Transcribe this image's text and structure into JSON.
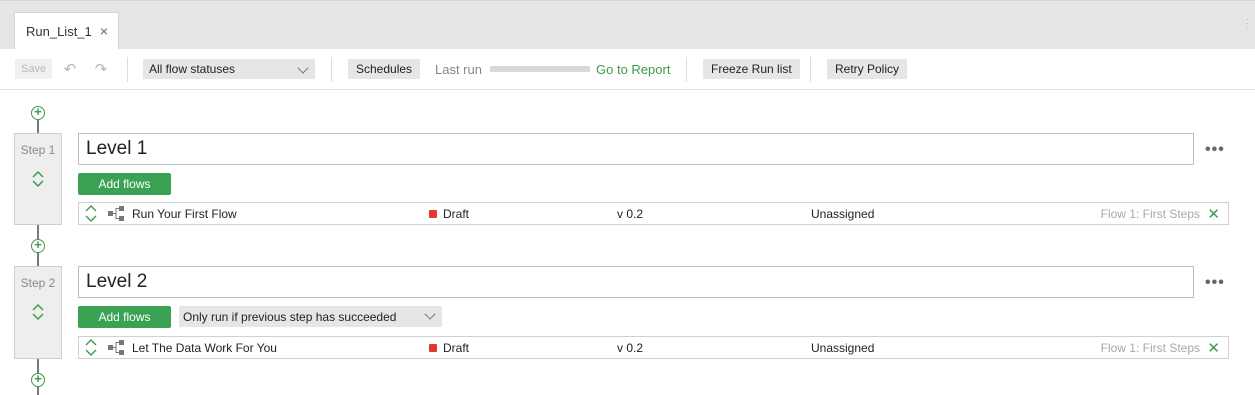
{
  "tab": {
    "label": "Run_List_1",
    "close_glyph": "×"
  },
  "toolbar": {
    "save_label": "Save",
    "undo_glyph": "↶",
    "redo_glyph": "↷",
    "status_filter": "All flow statuses",
    "schedules_label": "Schedules",
    "last_run_label": "Last run",
    "last_run_progress": 0,
    "goto_report_label": "Go to Report",
    "freeze_label": "Freeze Run list",
    "retry_label": "Retry Policy"
  },
  "steps": [
    {
      "label": "Step 1",
      "level": "Level 1",
      "add_flows_label": "Add flows",
      "condition": null,
      "flows": [
        {
          "name": "Run Your First Flow",
          "status": "Draft",
          "status_color": "#e23a2a",
          "version": "v 0.2",
          "assignee": "Unassigned",
          "flow_link": "Flow 1: First Steps"
        }
      ]
    },
    {
      "label": "Step 2",
      "level": "Level 2",
      "add_flows_label": "Add flows",
      "condition": "Only run if previous step has succeeded",
      "flows": [
        {
          "name": "Let The Data Work For You",
          "status": "Draft",
          "status_color": "#e23a2a",
          "version": "v 0.2",
          "assignee": "Unassigned",
          "flow_link": "Flow 1: First Steps"
        }
      ]
    }
  ],
  "icons": {
    "more": "•••",
    "remove": "✕",
    "add": "+"
  },
  "colors": {
    "accent_green": "#3aa353",
    "draft_red": "#e23a2a"
  }
}
